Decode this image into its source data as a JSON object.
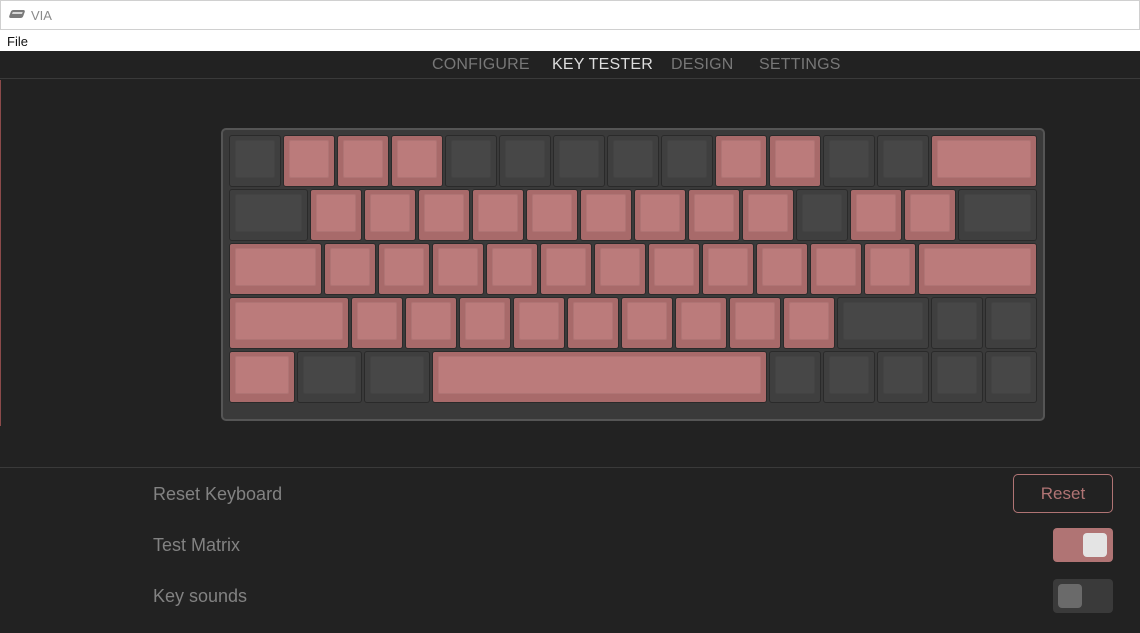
{
  "window": {
    "title": "VIA"
  },
  "menu": {
    "file": "File"
  },
  "nav": {
    "tabs": [
      {
        "label": "CONFIGURE",
        "active": false
      },
      {
        "label": "KEY TESTER",
        "active": true
      },
      {
        "label": "DESIGN",
        "active": false
      },
      {
        "label": "SETTINGS",
        "active": false
      }
    ]
  },
  "keyboard": {
    "rows": [
      [
        {
          "w": 1,
          "on": false
        },
        {
          "w": 1,
          "on": true
        },
        {
          "w": 1,
          "on": true
        },
        {
          "w": 1,
          "on": true
        },
        {
          "w": 1,
          "on": false
        },
        {
          "w": 1,
          "on": false
        },
        {
          "w": 1,
          "on": false
        },
        {
          "w": 1,
          "on": false
        },
        {
          "w": 1,
          "on": false
        },
        {
          "w": 1,
          "on": true
        },
        {
          "w": 1,
          "on": true
        },
        {
          "w": 1,
          "on": false
        },
        {
          "w": 1,
          "on": false
        },
        {
          "w": 2,
          "on": true
        }
      ],
      [
        {
          "w": 1.5,
          "on": false
        },
        {
          "w": 1,
          "on": true
        },
        {
          "w": 1,
          "on": true
        },
        {
          "w": 1,
          "on": true
        },
        {
          "w": 1,
          "on": true
        },
        {
          "w": 1,
          "on": true
        },
        {
          "w": 1,
          "on": true
        },
        {
          "w": 1,
          "on": true
        },
        {
          "w": 1,
          "on": true
        },
        {
          "w": 1,
          "on": true
        },
        {
          "w": 1,
          "on": false
        },
        {
          "w": 1,
          "on": true
        },
        {
          "w": 1,
          "on": true
        },
        {
          "w": 1.5,
          "on": false
        }
      ],
      [
        {
          "w": 1.75,
          "on": true
        },
        {
          "w": 1,
          "on": true
        },
        {
          "w": 1,
          "on": true
        },
        {
          "w": 1,
          "on": true
        },
        {
          "w": 1,
          "on": true
        },
        {
          "w": 1,
          "on": true
        },
        {
          "w": 1,
          "on": true
        },
        {
          "w": 1,
          "on": true
        },
        {
          "w": 1,
          "on": true
        },
        {
          "w": 1,
          "on": true
        },
        {
          "w": 1,
          "on": true
        },
        {
          "w": 1,
          "on": true
        },
        {
          "w": 2.25,
          "on": true
        }
      ],
      [
        {
          "w": 2.25,
          "on": true
        },
        {
          "w": 1,
          "on": true
        },
        {
          "w": 1,
          "on": true
        },
        {
          "w": 1,
          "on": true
        },
        {
          "w": 1,
          "on": true
        },
        {
          "w": 1,
          "on": true
        },
        {
          "w": 1,
          "on": true
        },
        {
          "w": 1,
          "on": true
        },
        {
          "w": 1,
          "on": true
        },
        {
          "w": 1,
          "on": true
        },
        {
          "w": 1.75,
          "on": false
        },
        {
          "w": 1,
          "on": false
        },
        {
          "w": 1,
          "on": false
        }
      ],
      [
        {
          "w": 1.25,
          "on": true
        },
        {
          "w": 1.25,
          "on": false
        },
        {
          "w": 1.25,
          "on": false
        },
        {
          "w": 6.25,
          "on": true
        },
        {
          "w": 1,
          "on": false
        },
        {
          "w": 1,
          "on": false
        },
        {
          "w": 1,
          "on": false
        },
        {
          "w": 1,
          "on": false
        },
        {
          "w": 1,
          "on": false
        }
      ]
    ]
  },
  "settings": {
    "reset_keyboard": {
      "label": "Reset Keyboard",
      "button": "Reset"
    },
    "test_matrix": {
      "label": "Test Matrix",
      "enabled": true
    },
    "key_sounds": {
      "label": "Key sounds",
      "enabled": false
    }
  },
  "colors": {
    "accent": "#b07474",
    "key_pressed": "#a86a6a",
    "key_idle": "#3f3f3f",
    "background": "#222222"
  }
}
